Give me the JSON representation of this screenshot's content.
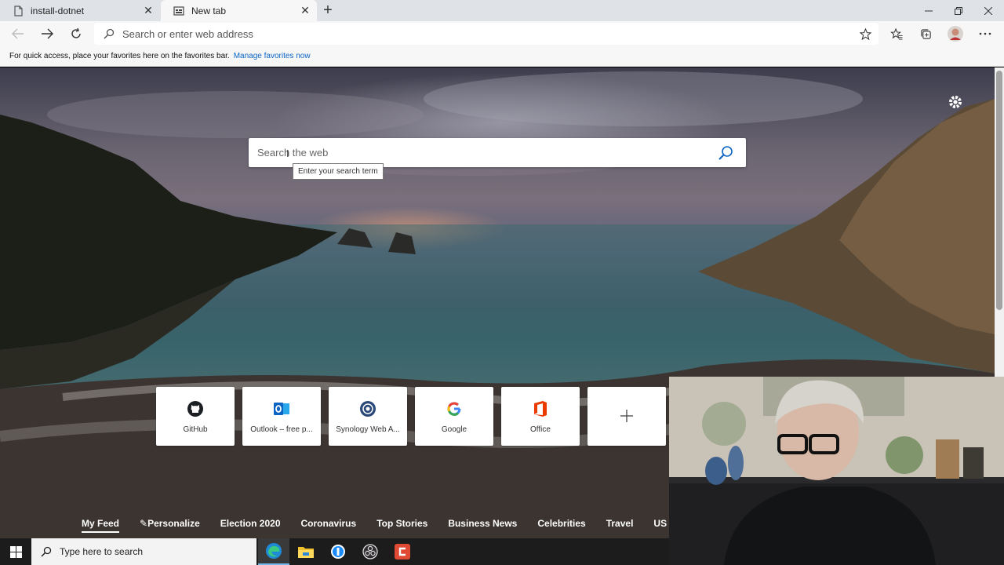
{
  "tabs": [
    {
      "label": "install-dotnet",
      "active": false,
      "icon": "document-icon"
    },
    {
      "label": "New tab",
      "active": true,
      "icon": "new-tab-page-icon"
    }
  ],
  "address_bar": {
    "placeholder": "Search or enter web address"
  },
  "favorites_bar": {
    "message": "For quick access, place your favorites here on the favorites bar.",
    "link": "Manage favorites now"
  },
  "search": {
    "placeholder": "Search the web",
    "tooltip": "Enter your search term"
  },
  "quick_links": [
    {
      "label": "GitHub",
      "icon": "github-icon"
    },
    {
      "label": "Outlook – free p...",
      "icon": "outlook-icon"
    },
    {
      "label": "Synology Web A...",
      "icon": "synology-icon"
    },
    {
      "label": "Google",
      "icon": "google-icon"
    },
    {
      "label": "Office",
      "icon": "office-icon"
    },
    {
      "label": "",
      "icon": "add-icon"
    }
  ],
  "news_nav": [
    {
      "label": "My Feed",
      "active": true
    },
    {
      "label": "Personalize",
      "active": false,
      "icon": "pencil-icon"
    },
    {
      "label": "Election 2020",
      "active": false
    },
    {
      "label": "Coronavirus",
      "active": false
    },
    {
      "label": "Top Stories",
      "active": false
    },
    {
      "label": "Business News",
      "active": false
    },
    {
      "label": "Celebrities",
      "active": false
    },
    {
      "label": "Travel",
      "active": false
    },
    {
      "label": "US News",
      "active": false
    }
  ],
  "taskbar": {
    "search_placeholder": "Type here to search",
    "apps": [
      "edge-icon",
      "file-explorer-icon",
      "1password-icon",
      "obs-icon",
      "camtasia-icon"
    ]
  },
  "colors": {
    "accent_link": "#0a64c4",
    "tab_strip": "#dfe3e8",
    "taskbar": "#1c1c1c"
  }
}
